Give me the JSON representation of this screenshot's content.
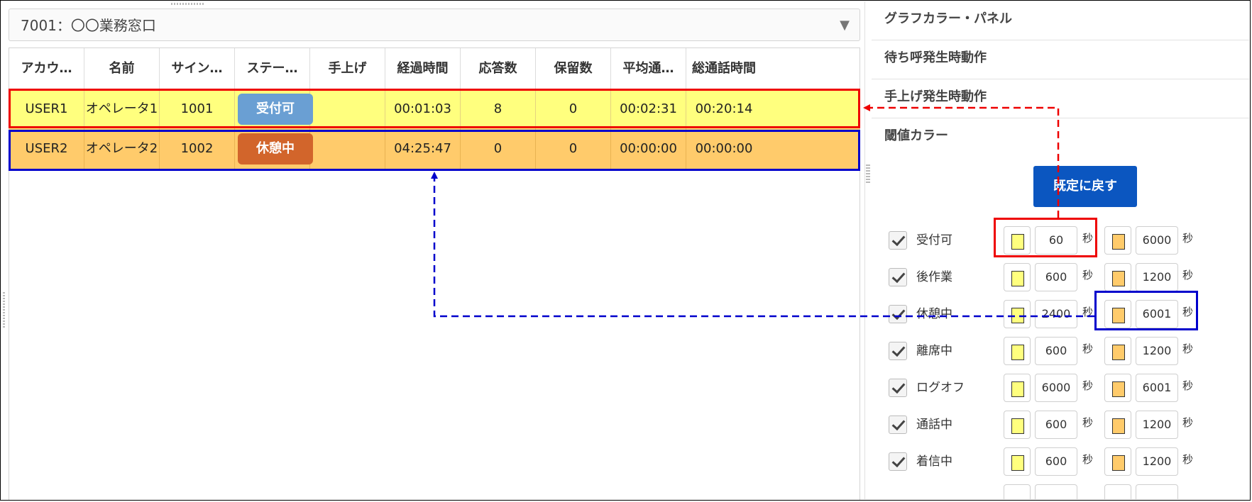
{
  "queue_select": {
    "value": "7001：〇〇業務窓口"
  },
  "columns": [
    "アカウ…",
    "名前",
    "サイン…",
    "ステー…",
    "手上げ",
    "経過時間",
    "応答数",
    "保留数",
    "平均通…",
    "総通話時間"
  ],
  "rows": [
    {
      "account": "USER1",
      "name": "オペレータ1",
      "sign_in": "1001",
      "status": "受付可",
      "status_color": "#6a9fd3",
      "hand": "",
      "elapsed": "00:01:03",
      "answered": "8",
      "held": "0",
      "avg": "00:02:31",
      "total": "00:20:14",
      "bg": "#ffff7e"
    },
    {
      "account": "USER2",
      "name": "オペレータ2",
      "sign_in": "1002",
      "status": "休憩中",
      "status_color": "#d2652b",
      "hand": "",
      "elapsed": "04:25:47",
      "answered": "0",
      "held": "0",
      "avg": "00:00:00",
      "total": "00:00:00",
      "bg": "#ffcb6b"
    }
  ],
  "panels": [
    "グラフカラー・パネル",
    "待ち呼発生時動作",
    "手上げ発生時動作",
    "閾値カラー"
  ],
  "reset_label": "既定に戻す",
  "unit": "秒",
  "colors": {
    "yellow": "#ffff7e",
    "orange": "#ffcb6b"
  },
  "thresholds": [
    {
      "label": "受付可",
      "checked": true,
      "v1": "60",
      "v2": "6000"
    },
    {
      "label": "後作業",
      "checked": true,
      "v1": "600",
      "v2": "1200"
    },
    {
      "label": "休憩中",
      "checked": true,
      "v1": "2400",
      "v2": "6001"
    },
    {
      "label": "離席中",
      "checked": true,
      "v1": "600",
      "v2": "1200"
    },
    {
      "label": "ログオフ",
      "checked": true,
      "v1": "6000",
      "v2": "6001"
    },
    {
      "label": "通話中",
      "checked": true,
      "v1": "600",
      "v2": "1200"
    },
    {
      "label": "着信中",
      "checked": true,
      "v1": "600",
      "v2": "1200"
    }
  ]
}
